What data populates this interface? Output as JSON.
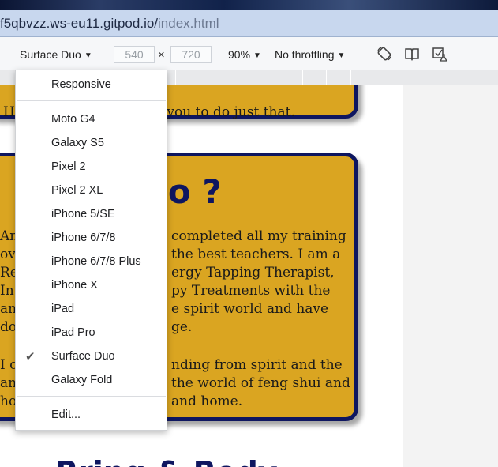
{
  "browser": {
    "url_host": "f5qbvzz.ws-eu11.gitpod.io/",
    "url_path": "index.html"
  },
  "toolbar": {
    "device": "Surface Duo",
    "width": "540",
    "height": "720",
    "times": "×",
    "zoom": "90%",
    "throttling": "No throttling",
    "icons": [
      "rotate-icon",
      "dual-screen-icon",
      "sensor-settings-icon"
    ]
  },
  "dropdown": {
    "responsive": "Responsive",
    "devices": [
      "Moto G4",
      "Galaxy S5",
      "Pixel 2",
      "Pixel 2 XL",
      "iPhone 5/SE",
      "iPhone 6/7/8",
      "iPhone 6/7/8 Plus",
      "iPhone X",
      "iPad",
      "iPad Pro",
      "Surface Duo",
      "Galaxy Fold"
    ],
    "selected": "Surface Duo",
    "edit": "Edit..."
  },
  "page": {
    "card1_line": "He",
    "card1_line_right": "h you to do just that.",
    "card2_heading": "ho ?",
    "card2_left": [
      "An",
      "ov",
      "Re",
      "In",
      "an",
      "do",
      "",
      "I o",
      "an",
      "ho"
    ],
    "card2_right": [
      "completed all my training",
      "the best teachers. I am a",
      "ergy Tapping Therapist,",
      "py Treatments with the",
      "e spirit world and have",
      "ge.",
      "",
      "nding from spirit and the",
      "the world of feng shui and",
      "and home."
    ],
    "bottom_heading": "Bring & Body"
  },
  "colors": {
    "card_bg": "#daa521",
    "card_border": "#0e1660",
    "url_bar": "#c8d7ee"
  }
}
